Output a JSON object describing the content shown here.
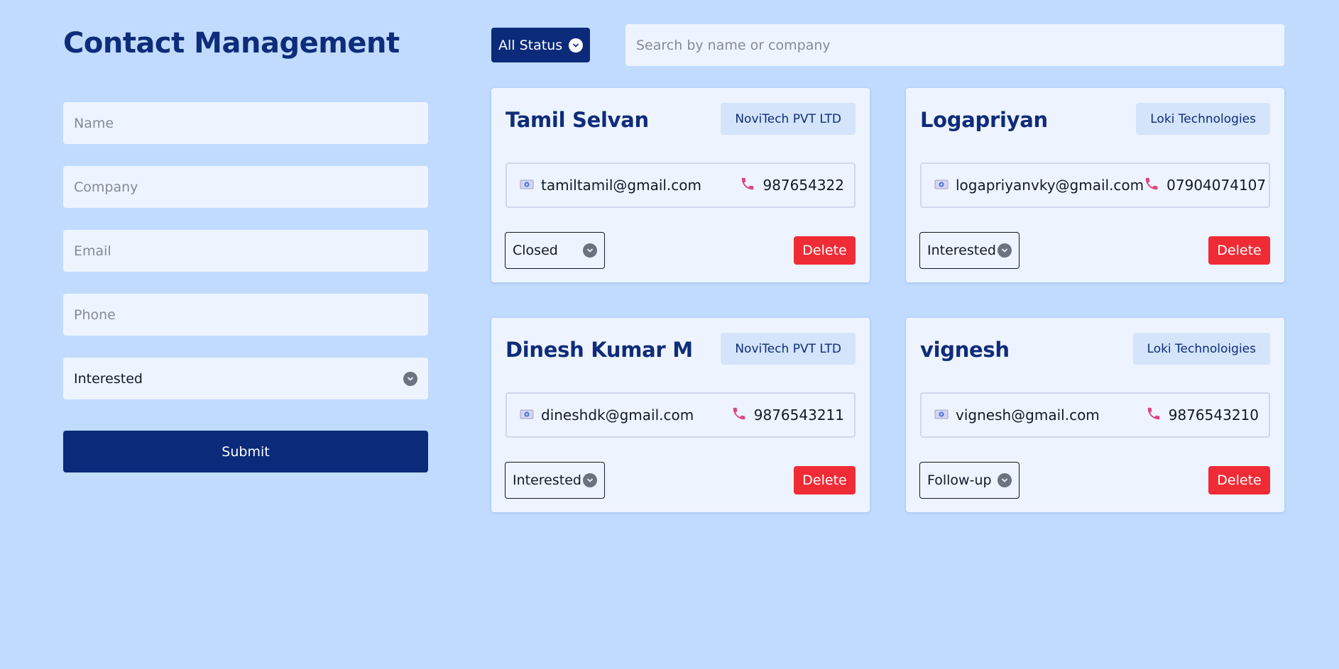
{
  "page": {
    "title": "Contact Management"
  },
  "form": {
    "name_placeholder": "Name",
    "company_placeholder": "Company",
    "email_placeholder": "Email",
    "phone_placeholder": "Phone",
    "status_selected": "Interested",
    "submit_label": "Submit"
  },
  "filter": {
    "status_selected": "All Status"
  },
  "search": {
    "placeholder": "Search by name or company"
  },
  "contacts": [
    {
      "name": "Tamil Selvan",
      "company": "NoviTech PVT LTD",
      "email": "tamiltamil@gmail.com",
      "phone": "987654322",
      "status": "Closed",
      "delete_label": "Delete"
    },
    {
      "name": "Logapriyan",
      "company": "Loki Technologies",
      "email": "logapriyanvky@gmail.com",
      "phone": "07904074107",
      "status": "Interested",
      "delete_label": "Delete"
    },
    {
      "name": "Dinesh Kumar M",
      "company": "NoviTech PVT LTD",
      "email": "dineshdk@gmail.com",
      "phone": "9876543211",
      "status": "Interested",
      "delete_label": "Delete"
    },
    {
      "name": "vignesh",
      "company": "Loki Technoloigies",
      "email": "vignesh@gmail.com",
      "phone": "9876543210",
      "status": "Follow-up",
      "delete_label": "Delete"
    }
  ],
  "icons": {
    "email": "email-icon",
    "phone": "phone-icon",
    "chevron": "chevron-down-icon"
  },
  "colors": {
    "background": "#c0dbfe",
    "primary": "#0b2a7a",
    "heading": "#0f2c7a",
    "danger": "#ef2b36",
    "card": "#eef4ff",
    "badge": "#d3e4fb"
  }
}
